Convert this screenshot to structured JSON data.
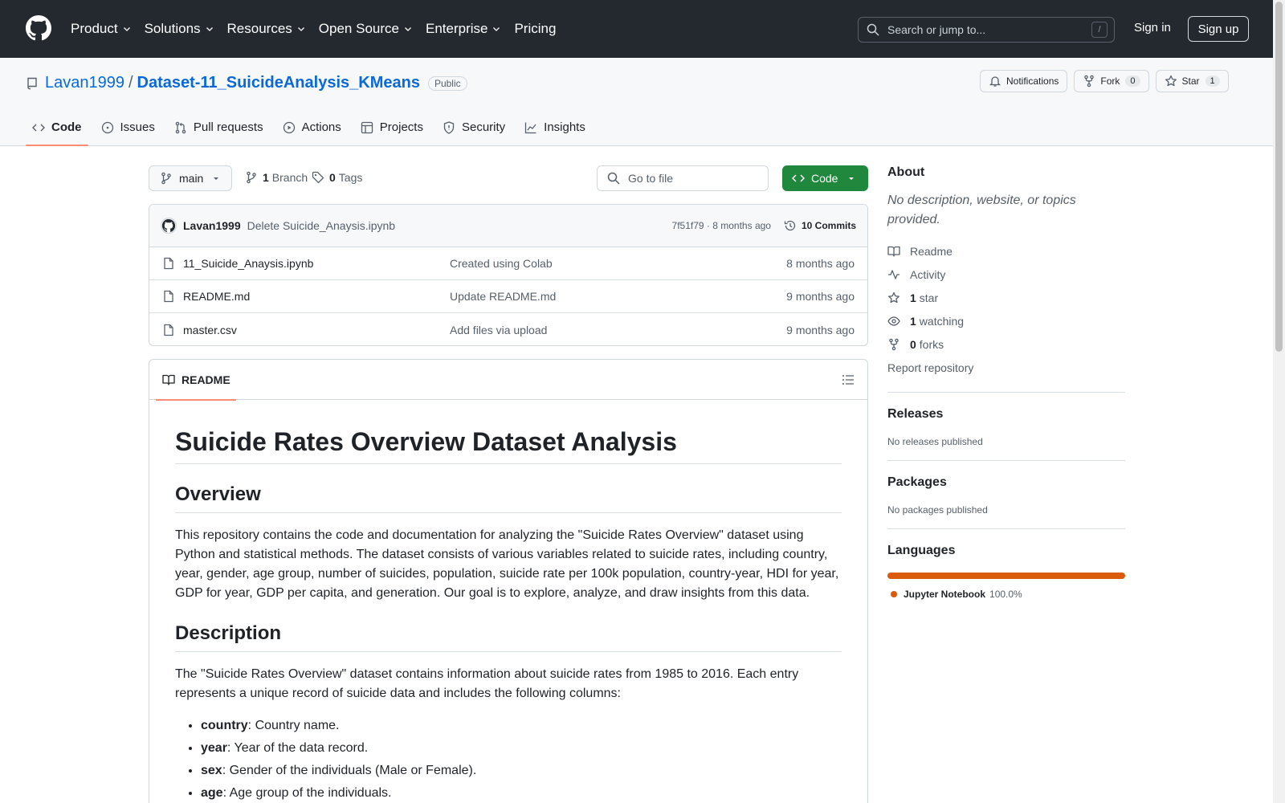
{
  "header": {
    "nav": [
      "Product",
      "Solutions",
      "Resources",
      "Open Source",
      "Enterprise",
      "Pricing"
    ],
    "search_placeholder": "Search or jump to...",
    "search_key": "/",
    "signin": "Sign in",
    "signup": "Sign up"
  },
  "repo": {
    "owner": "Lavan1999",
    "separator": "/",
    "name": "Dataset-11_SuicideAnalysis_KMeans",
    "visibility": "Public",
    "notifications": "Notifications",
    "fork_label": "Fork",
    "fork_count": "0",
    "star_label": "Star",
    "star_count": "1"
  },
  "tabs": [
    "Code",
    "Issues",
    "Pull requests",
    "Actions",
    "Projects",
    "Security",
    "Insights"
  ],
  "branch": {
    "name": "main",
    "branch_count": "1",
    "branch_label": "Branch",
    "tag_count": "0",
    "tag_label": "Tags",
    "goto_placeholder": "Go to file",
    "code_button": "Code"
  },
  "commit": {
    "author": "Lavan1999",
    "message": "Delete Suicide_Anaysis.ipynb",
    "sha_time": "7f51f79 · 8 months ago",
    "commits": "10 Commits"
  },
  "files": [
    {
      "name": "11_Suicide_Anaysis.ipynb",
      "message": "Created using Colab",
      "time": "8 months ago"
    },
    {
      "name": "README.md",
      "message": "Update README.md",
      "time": "9 months ago"
    },
    {
      "name": "master.csv",
      "message": "Add files via upload",
      "time": "9 months ago"
    }
  ],
  "readme": {
    "tab": "README",
    "title": "Suicide Rates Overview Dataset Analysis",
    "overview_heading": "Overview",
    "overview_text": "This repository contains the code and documentation for analyzing the \"Suicide Rates Overview\" dataset using Python and statistical methods. The dataset consists of various variables related to suicide rates, including country, year, gender, age group, number of suicides, population, suicide rate per 100k population, country-year, HDI for year, GDP for year, GDP per capita, and generation. Our goal is to explore, analyze, and draw insights from this data.",
    "description_heading": "Description",
    "description_text": "The \"Suicide Rates Overview\" dataset contains information about suicide rates from 1985 to 2016. Each entry represents a unique record of suicide data and includes the following columns:",
    "columns": [
      {
        "term": "country",
        "desc": ": Country name."
      },
      {
        "term": "year",
        "desc": ": Year of the data record."
      },
      {
        "term": "sex",
        "desc": ": Gender of the individuals (Male or Female)."
      },
      {
        "term": "age",
        "desc": ": Age group of the individuals."
      }
    ]
  },
  "sidebar": {
    "about_heading": "About",
    "about_desc": "No description, website, or topics provided.",
    "readme": "Readme",
    "activity": "Activity",
    "stars_count": "1",
    "stars_label": "star",
    "watching_count": "1",
    "watching_label": "watching",
    "forks_count": "0",
    "forks_label": "forks",
    "report": "Report repository",
    "releases_heading": "Releases",
    "releases_text": "No releases published",
    "packages_heading": "Packages",
    "packages_text": "No packages published",
    "languages_heading": "Languages",
    "language_name": "Jupyter Notebook",
    "language_pct": "100.0%",
    "language_color": "#da5b0b"
  }
}
